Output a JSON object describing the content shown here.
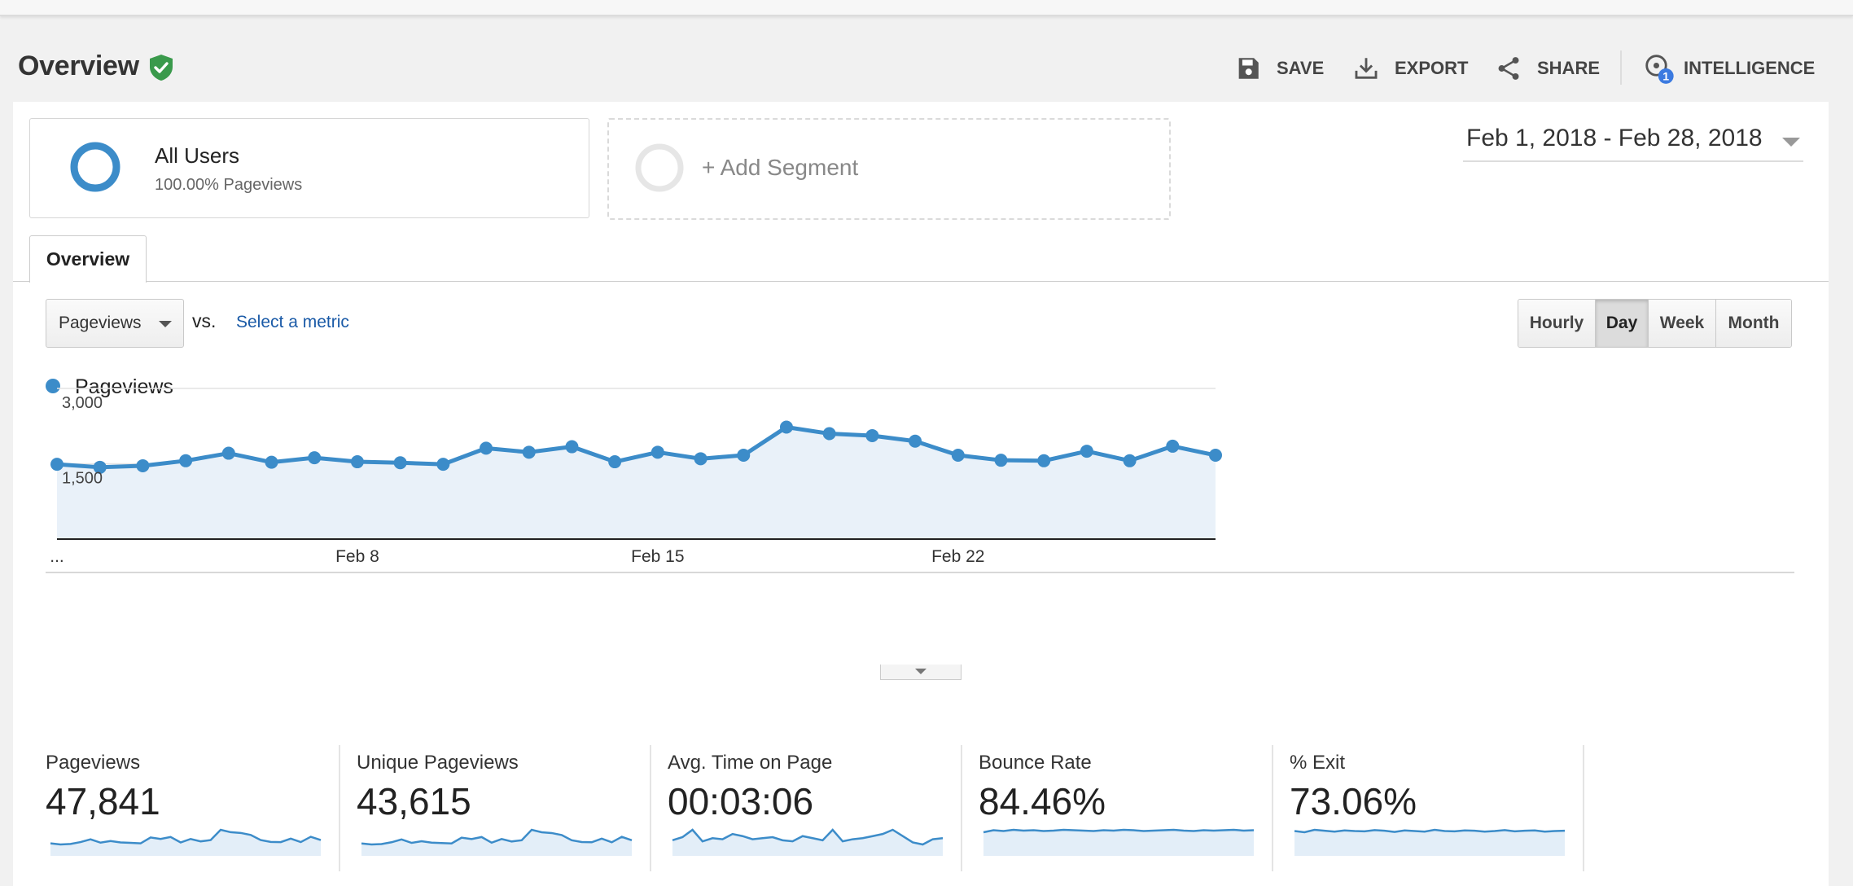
{
  "header": {
    "title": "Overview",
    "actions": [
      {
        "label": "SAVE",
        "icon": "save-icon"
      },
      {
        "label": "EXPORT",
        "icon": "download-icon"
      },
      {
        "label": "SHARE",
        "icon": "share-icon"
      },
      {
        "label": "INTELLIGENCE",
        "icon": "intelligence-icon",
        "badge": "1"
      }
    ],
    "verified_color": "#3a9a4c"
  },
  "segments": {
    "active": {
      "name": "All Users",
      "detail": "100.00% Pageviews",
      "color": "#3c8cc9"
    },
    "add_label": "+ Add Segment"
  },
  "date_range": "Feb 1, 2018 - Feb 28, 2018",
  "tabs": [
    {
      "label": "Overview"
    }
  ],
  "controls": {
    "metric": "Pageviews",
    "vs_label": "vs.",
    "select_metric": "Select a metric",
    "granularity": [
      "Hourly",
      "Day",
      "Week",
      "Month"
    ],
    "active_granularity": "Day"
  },
  "chart_data": {
    "type": "area",
    "series": [
      {
        "name": "Pageviews",
        "color": "#3c8cc9",
        "values": [
          1490,
          1430,
          1460,
          1560,
          1710,
          1530,
          1620,
          1540,
          1520,
          1490,
          1810,
          1730,
          1840,
          1540,
          1730,
          1600,
          1670,
          2230,
          2100,
          2060,
          1950,
          1670,
          1570,
          1560,
          1750,
          1560,
          1850,
          1670
        ]
      }
    ],
    "x": [
      "Feb 1",
      "Feb 2",
      "Feb 3",
      "Feb 4",
      "Feb 5",
      "Feb 6",
      "Feb 7",
      "Feb 8",
      "Feb 9",
      "Feb 10",
      "Feb 11",
      "Feb 12",
      "Feb 13",
      "Feb 14",
      "Feb 15",
      "Feb 16",
      "Feb 17",
      "Feb 18",
      "Feb 19",
      "Feb 20",
      "Feb 21",
      "Feb 22",
      "Feb 23",
      "Feb 24",
      "Feb 25",
      "Feb 26",
      "Feb 27",
      "Feb 28"
    ],
    "x_tick_labels": [
      "...",
      "Feb 8",
      "Feb 15",
      "Feb 22"
    ],
    "y_tick_labels": [
      "3,000",
      "1,500"
    ],
    "ylim": [
      0,
      3000
    ],
    "grid": true,
    "legend": "top-left"
  },
  "stats": [
    {
      "label": "Pageviews",
      "value": "47,841",
      "spark": [
        1490,
        1430,
        1460,
        1560,
        1710,
        1530,
        1620,
        1540,
        1520,
        1490,
        1810,
        1730,
        1840,
        1540,
        1730,
        1600,
        1670,
        2230,
        2100,
        2060,
        1950,
        1670,
        1570,
        1560,
        1750,
        1560,
        1850,
        1670
      ]
    },
    {
      "label": "Unique Pageviews",
      "value": "43,615",
      "spark": [
        1380,
        1330,
        1350,
        1440,
        1580,
        1410,
        1490,
        1420,
        1400,
        1380,
        1670,
        1600,
        1700,
        1420,
        1600,
        1480,
        1540,
        2060,
        1940,
        1900,
        1800,
        1540,
        1450,
        1440,
        1620,
        1440,
        1710,
        1540
      ]
    },
    {
      "label": "Avg. Time on Page",
      "value": "00:03:06",
      "spark": [
        180,
        195,
        230,
        175,
        190,
        185,
        210,
        200,
        185,
        190,
        195,
        180,
        175,
        200,
        190,
        180,
        230,
        175,
        185,
        190,
        200,
        210,
        230,
        200,
        170,
        160,
        185,
        190
      ]
    },
    {
      "label": "Bounce Rate",
      "value": "84.46%",
      "spark": [
        84,
        84.5,
        84.3,
        84.6,
        84.4,
        84.5,
        84.3,
        84.4,
        84.6,
        84.5,
        84.4,
        84.3,
        84.5,
        84.4,
        84.6,
        84.5,
        84.3,
        84.4,
        84.5,
        84.6,
        84.4,
        84.3,
        84.5,
        84.4,
        84.5,
        84.6,
        84.4,
        84.5
      ]
    },
    {
      "label": "% Exit",
      "value": "73.06%",
      "spark": [
        73,
        72.6,
        73.4,
        73.1,
        72.8,
        73.2,
        73.0,
        72.9,
        73.3,
        73.1,
        72.7,
        73.2,
        73.0,
        72.8,
        73.4,
        73.0,
        72.9,
        73.2,
        73.1,
        72.8,
        73.0,
        73.3,
        72.9,
        73.1,
        73.2,
        72.8,
        73.0,
        73.1
      ]
    }
  ]
}
